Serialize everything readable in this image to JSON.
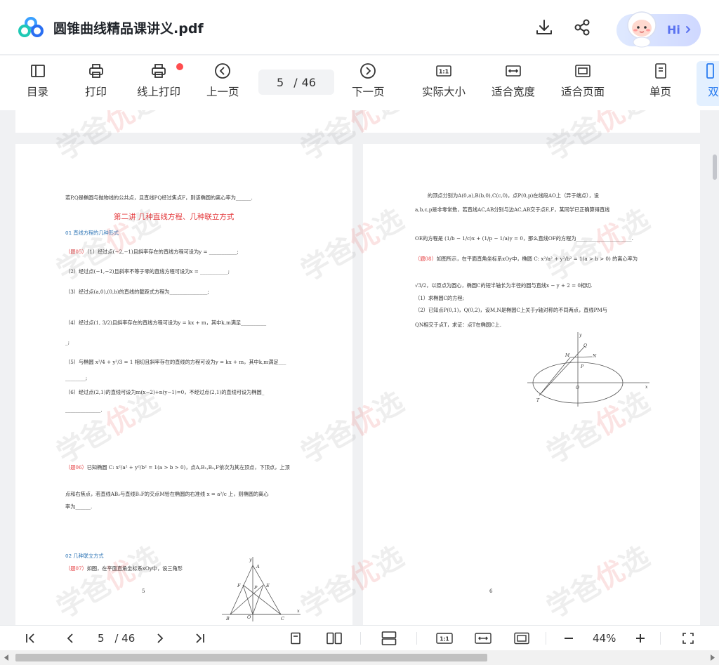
{
  "header": {
    "file_title": "圆锥曲线精品课讲义.pdf",
    "assistant_label": "Hi"
  },
  "toolbar": {
    "items": [
      {
        "label": "目录",
        "icon": "toc-icon"
      },
      {
        "label": "打印",
        "icon": "printer-icon"
      },
      {
        "label": "线上打印",
        "icon": "online-print-icon"
      },
      {
        "label": "上一页",
        "icon": "prev-page-icon"
      },
      {
        "label": "下一页",
        "icon": "next-page-icon"
      },
      {
        "label": "实际大小",
        "icon": "actual-size-icon"
      },
      {
        "label": "适合宽度",
        "icon": "fit-width-icon"
      },
      {
        "label": "适合页面",
        "icon": "fit-page-icon"
      },
      {
        "label": "单页",
        "icon": "single-page-icon"
      },
      {
        "label": "双",
        "icon": "double-page-icon"
      }
    ],
    "current_page": "5",
    "page_sep": "/",
    "total_pages": "46"
  },
  "watermark": {
    "a": "学爸",
    "b": "优",
    "c": "选"
  },
  "page5": {
    "q_intro": "若P,Q是椭圆与抛物线的公共点，且直线PQ经过焦点F，则该椭圆的离心率为______.",
    "lecture_title": "第二讲    几种直线方程、几种联立方式",
    "sec01": "01  直线方程的几种形式",
    "q05_tag": "（题05）",
    "q05_1": "（1）经过点(−2,−1)且斜率存在的直线方程可设为y = ___________;",
    "q05_2": "（2）经过点(−1,−2)且斜率不等于零的直线方程可设为x = ___________;",
    "q05_3": "（3）经过点(a,0),(0,b)的直线的截距式方程为_______________;",
    "q05_4": "（4）经过点(1, 3/2)且斜率存在的直线方程可设为y = kx + m，其中k,m满足__________",
    "q05_4b": "_;",
    "q05_5": "（5）与椭圆 x²/4 + y²/3 = 1 相切且斜率存在的直线的方程可设为y = kx + m，其中k,m满足___",
    "q05_5b": "________;",
    "q05_6": "（6）经过点(2,1)的直线可设为m(x−2)+n(y−1)=0，不经过点(2,1)的直线可设为椭圆_",
    "q05_6b": "______________.",
    "q06_tag": "（题06）",
    "q06_a": "已知椭圆 C: x²/a² + y²/b² = 1(a > b > 0)，点A,B₁,B₂,F依次为其左顶点，下顶点，上顶",
    "q06_b": "点和右焦点，若直线AB₂与直线B₁F的交点M恰在椭圆的右准线 x = a²/c 上，则椭圆的离心",
    "q06_c": "率为______.",
    "sec02": "02  几种联立方式",
    "q07_tag": "（题07）",
    "q07_a": "如图，在平面直角坐标系xOy中，设三角形",
    "page_num": "5",
    "fig_labels": {
      "y": "y",
      "x": "x",
      "A": "A",
      "B": "B",
      "C": "C",
      "O": "O",
      "E": "E",
      "F": "F",
      "P": "P"
    }
  },
  "page6": {
    "l1": "的顶点分别为A(0,a),B(b,0),C(c,0)，点P(0,p)在线段AO上（异于端点），设",
    "l2": "a,b,c,p是非零常数，若直线AC,AB分别与边AC,AB交于点E,F，某同学已正确算得直线",
    "l3": "OE的方程是 (1/b − 1/c)x + (1/p − 1/a)y = 0，那么直线OF的方程为______________________.",
    "q08_tag": "（题08）",
    "q08_a": "如图所示，在平面直角坐标系xOy中，椭圆 C: x²/a² + y²/b² = 1(a > b > 0) 的离心率为",
    "q08_b": "√3/2，以原点为圆心，椭圆C的短半轴长为半径的圆与直线x − y + 2 = 0相切.",
    "q08_1": "（1）求椭圆C的方程;",
    "q08_2": "（2）已知点P(0,1)，Q(0,2)，设M,N是椭圆C上关于y轴对称的不同两点，直线PM与",
    "q08_3": "QN相交于点T，求证：点T在椭圆C上.",
    "page_num": "6",
    "fig_labels": {
      "y": "y",
      "x": "x",
      "Q": "Q",
      "P": "P",
      "M": "M",
      "N": "N",
      "O": "O",
      "T": "T"
    }
  },
  "bottombar": {
    "current_page": "5",
    "page_sep": "/",
    "total_pages": "46",
    "zoom": "44%"
  }
}
